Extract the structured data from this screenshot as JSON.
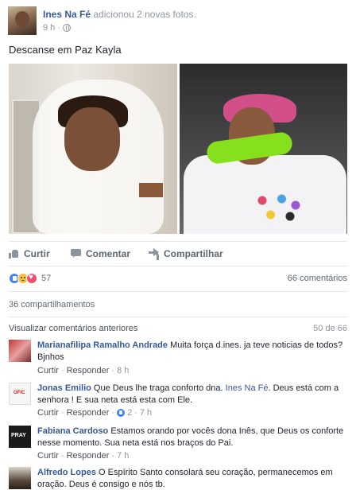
{
  "post": {
    "author": "Ines Na Fé",
    "action": "adicionou 2 novas fotos.",
    "time": "9 h",
    "separator": "·",
    "text": "Descanse em Paz Kayla"
  },
  "actions": {
    "like": "Curtir",
    "comment": "Comentar",
    "share": "Compartilhar"
  },
  "stats": {
    "reaction_count": "57",
    "comments": "66 comentários",
    "shares": "36 compartilhamentos",
    "reaction_types": [
      "like",
      "sad",
      "love"
    ]
  },
  "comments_section": {
    "view_previous": "Visualizar comentários anteriores",
    "paging": "50 de 66"
  },
  "comments": [
    {
      "name": "Marianafilipa Ramalho Andrade",
      "text": "Muita força d.ines. ja teve noticias de todos? Bjnhos",
      "like": "Curtir",
      "reply": "Responder",
      "time": "8 h",
      "dot": "·"
    },
    {
      "name": "Jonas Emilio",
      "text_before": "Que Deus lhe traga conforto dna.",
      "mention": "Ines Na Fé",
      "text_after": ". Deus está com a senhora ! E sua neta está esta com Ele.",
      "like": "Curtir",
      "reply": "Responder",
      "likes": "2",
      "time": "7 h",
      "dot": "·"
    },
    {
      "name": "Fabiana Cardoso",
      "text": "Estamos orando por vocês dona Inês, que Deus os conforte nesse momento. Sua neta está nos braços do Pai.",
      "like": "Curtir",
      "reply": "Responder",
      "time": "7 h",
      "dot": "·"
    },
    {
      "name": "Alfredo Lopes",
      "text": "O Espírito Santo consolará seu coração, permanecemos em oração. Deus é consigo e nós tb."
    }
  ],
  "colors": {
    "link": "#365899",
    "muted": "#90949c",
    "reaction_like": "#4080ff",
    "reaction_love": "#f0506e",
    "reaction_sad": "#f7c33c"
  }
}
